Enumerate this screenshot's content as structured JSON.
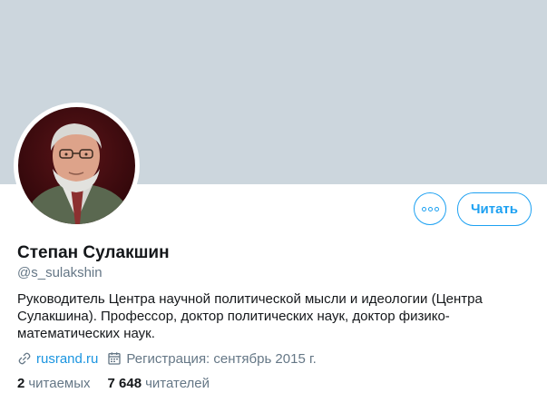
{
  "profile": {
    "display_name": "Степан Сулакшин",
    "handle": "@s_sulakshin",
    "bio": "Руководитель Центра научной политической мысли и идеологии (Центра Сулакшина). Профессор, доктор политических наук, доктор физико-математических наук.",
    "website": "rusrand.ru",
    "joined": "Регистрация: сентябрь 2015 г."
  },
  "actions": {
    "follow_label": "Читать",
    "more_icon": "more-horizontal-icon"
  },
  "stats": {
    "following_count": "2",
    "following_label": "читаемых",
    "followers_count": "7 648",
    "followers_label": "читателей"
  },
  "icons": {
    "website": "link-icon",
    "joined": "calendar-icon"
  },
  "colors": {
    "banner": "#ccd6dd",
    "accent": "#1da1f2",
    "link": "#1b95e0",
    "secondary_text": "#657786",
    "primary_text": "#14171a"
  }
}
